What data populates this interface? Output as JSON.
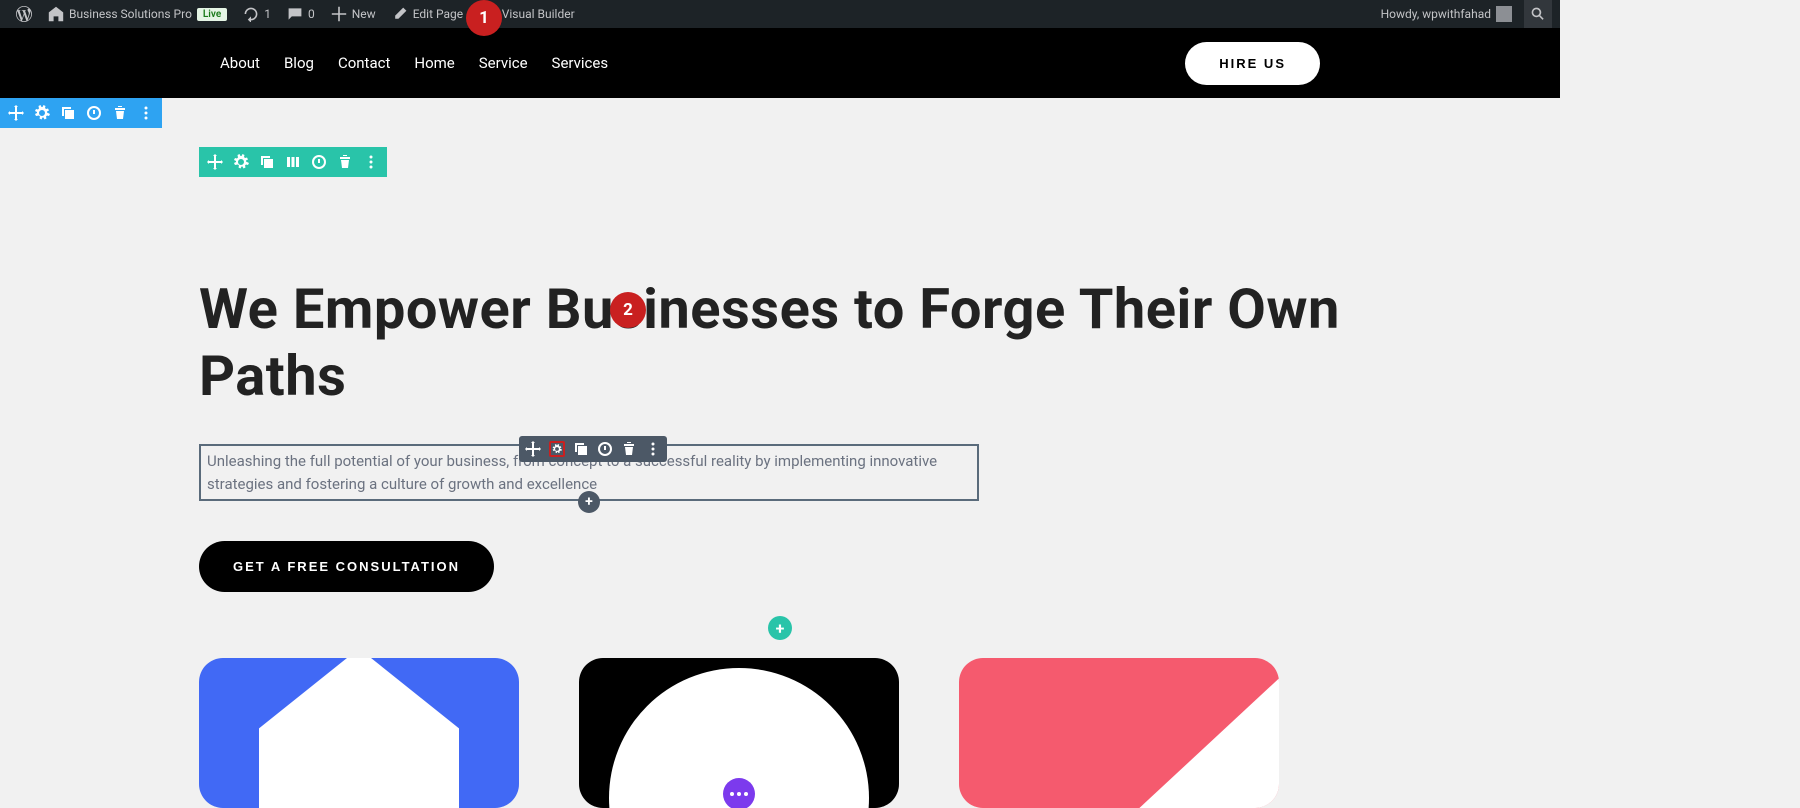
{
  "adminBar": {
    "siteName": "Business Solutions Pro",
    "liveBadge": "Live",
    "updates": "1",
    "comments": "0",
    "newLabel": "New",
    "editPageLabel": "Edit Page",
    "exitBuilderLabel": "Exit Visual Builder",
    "greeting": "Howdy, wpwithfahad"
  },
  "nav": {
    "items": [
      "About",
      "Blog",
      "Contact",
      "Home",
      "Service",
      "Services"
    ],
    "hireBtn": "HIRE US"
  },
  "hero": {
    "headline": "We Empower Businesses to Forge Their Own Paths",
    "subtext": "Unleashing the full potential of your business, from concept to a successful reality by implementing innovative strategies and fostering a culture of growth and excellence",
    "ctaBtn": "GET A FREE CONSULTATION"
  },
  "annotations": {
    "a1": "1",
    "a2": "2"
  },
  "icons": {
    "plus": "+",
    "dots": "⋮"
  }
}
